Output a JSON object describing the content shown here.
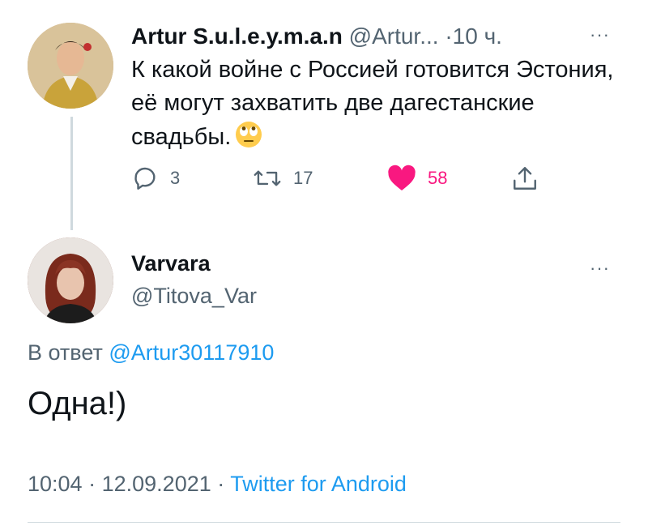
{
  "parent": {
    "author_name": "Artur S.u.l.e.y.m.a.n",
    "author_handle": "@Artur...",
    "separator": "·",
    "time": "10 ч.",
    "more": "···",
    "text": "К какой войне с Россией готовится Эстония, её могут захватить две дагестанские свадьбы.",
    "emoji": "face-with-rolling-eyes",
    "reply_count": "3",
    "retweet_count": "17",
    "like_count": "58",
    "like_color": "#f91880"
  },
  "reply": {
    "author_name": "Varvara",
    "author_handle": "@Titova_Var",
    "more": "···",
    "in_reply_prefix": "В ответ",
    "in_reply_mention": "@Artur30117910",
    "text": "Одна!)",
    "time": "10:04",
    "date": "12.09.2021",
    "meta_separator": "·",
    "source": "Twitter for Android"
  },
  "colors": {
    "link": "#1d9bf0",
    "secondary_text": "#536471",
    "primary_text": "#0f1419"
  }
}
